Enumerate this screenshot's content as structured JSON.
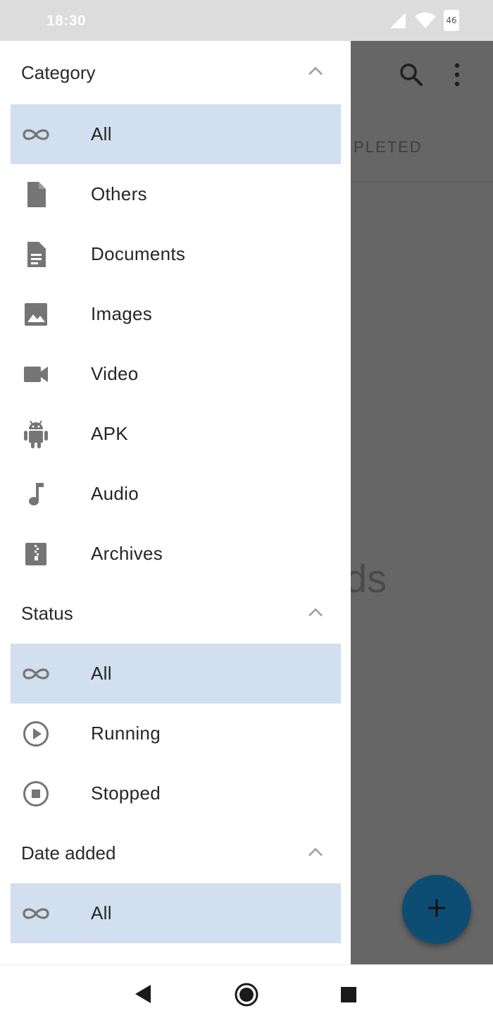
{
  "status_bar": {
    "time": "18:30",
    "battery_level": "46"
  },
  "background_app": {
    "tab_fragment": "IPLETED",
    "empty_text_fragment": "ds"
  },
  "drawer": {
    "sections": [
      {
        "title": "Category",
        "items": [
          {
            "label": "All",
            "icon": "infinity-icon",
            "selected": true
          },
          {
            "label": "Others",
            "icon": "file-icon",
            "selected": false
          },
          {
            "label": "Documents",
            "icon": "document-icon",
            "selected": false
          },
          {
            "label": "Images",
            "icon": "image-icon",
            "selected": false
          },
          {
            "label": "Video",
            "icon": "video-camera-icon",
            "selected": false
          },
          {
            "label": "APK",
            "icon": "android-icon",
            "selected": false
          },
          {
            "label": "Audio",
            "icon": "music-note-icon",
            "selected": false
          },
          {
            "label": "Archives",
            "icon": "archive-icon",
            "selected": false
          }
        ]
      },
      {
        "title": "Status",
        "items": [
          {
            "label": "All",
            "icon": "infinity-icon",
            "selected": true
          },
          {
            "label": "Running",
            "icon": "play-circle-icon",
            "selected": false
          },
          {
            "label": "Stopped",
            "icon": "stop-circle-icon",
            "selected": false
          }
        ]
      },
      {
        "title": "Date added",
        "items": [
          {
            "label": "All",
            "icon": "infinity-icon",
            "selected": true
          }
        ]
      }
    ]
  },
  "colors": {
    "selected_bg": "#d2dfee",
    "icon_gray": "#757575",
    "fab": "#0d4d73",
    "scrim": "#666666"
  }
}
